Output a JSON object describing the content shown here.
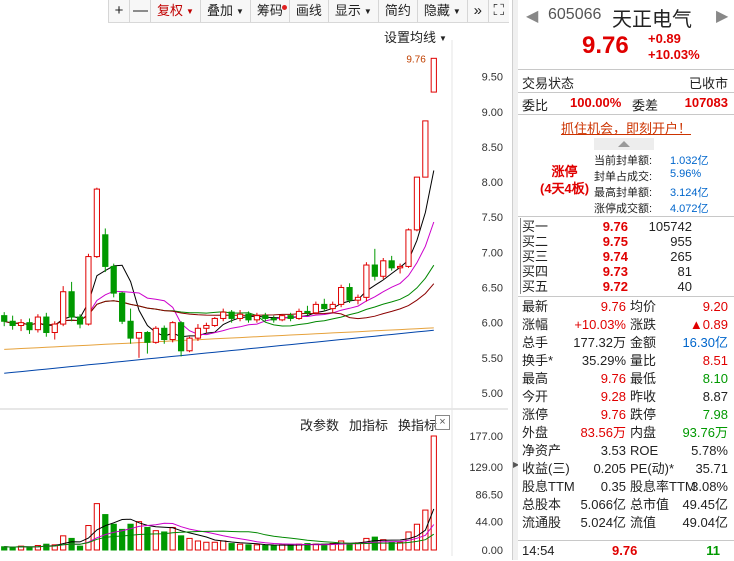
{
  "toolbar": {
    "plus": "+",
    "minus": "—",
    "items": [
      "复权",
      "叠加",
      "筹码",
      "画线",
      "显示",
      "简约",
      "隐藏",
      "»",
      "⛶"
    ]
  },
  "chart": {
    "ma_settings": "设置均线",
    "price_marker": "9.76",
    "y_labels": [
      "9.50",
      "9.00",
      "8.50",
      "8.00",
      "7.50",
      "7.00",
      "6.50",
      "6.00",
      "5.50",
      "5.00"
    ],
    "vol_labels": [
      "177.00",
      "129.00",
      "86.50",
      "44.00",
      "0.00"
    ],
    "indicator_links": [
      "改参数",
      "加指标",
      "换指标"
    ],
    "close": "×"
  },
  "chart_data": {
    "type": "candlestick",
    "ylim": [
      4.9,
      9.85
    ],
    "candles": [
      {
        "o": 6.1,
        "h": 6.15,
        "l": 5.95,
        "c": 6.02
      },
      {
        "o": 6.02,
        "h": 6.1,
        "l": 5.9,
        "c": 5.96
      },
      {
        "o": 5.96,
        "h": 6.05,
        "l": 5.88,
        "c": 6.0
      },
      {
        "o": 6.0,
        "h": 6.06,
        "l": 5.84,
        "c": 5.9
      },
      {
        "o": 5.9,
        "h": 6.12,
        "l": 5.86,
        "c": 6.08
      },
      {
        "o": 6.08,
        "h": 6.14,
        "l": 5.8,
        "c": 5.86
      },
      {
        "o": 5.86,
        "h": 6.02,
        "l": 5.76,
        "c": 5.98
      },
      {
        "o": 5.98,
        "h": 6.52,
        "l": 5.95,
        "c": 6.44
      },
      {
        "o": 6.44,
        "h": 6.58,
        "l": 6.02,
        "c": 6.08
      },
      {
        "o": 6.08,
        "h": 6.12,
        "l": 5.92,
        "c": 5.98
      },
      {
        "o": 5.98,
        "h": 6.98,
        "l": 5.96,
        "c": 6.94
      },
      {
        "o": 6.94,
        "h": 7.92,
        "l": 6.92,
        "c": 7.9
      },
      {
        "o": 7.25,
        "h": 7.34,
        "l": 6.72,
        "c": 6.8
      },
      {
        "o": 6.8,
        "h": 6.84,
        "l": 6.36,
        "c": 6.42
      },
      {
        "o": 6.42,
        "h": 6.44,
        "l": 5.98,
        "c": 6.02
      },
      {
        "o": 6.02,
        "h": 6.2,
        "l": 5.7,
        "c": 5.78
      },
      {
        "o": 5.78,
        "h": 5.82,
        "l": 5.5,
        "c": 5.86
      },
      {
        "o": 5.86,
        "h": 5.88,
        "l": 5.56,
        "c": 5.72
      },
      {
        "o": 5.72,
        "h": 5.95,
        "l": 5.7,
        "c": 5.92
      },
      {
        "o": 5.92,
        "h": 5.96,
        "l": 5.7,
        "c": 5.76
      },
      {
        "o": 5.76,
        "h": 6.02,
        "l": 5.72,
        "c": 6.0
      },
      {
        "o": 6.0,
        "h": 6.02,
        "l": 5.52,
        "c": 5.6
      },
      {
        "o": 5.6,
        "h": 5.8,
        "l": 5.58,
        "c": 5.78
      },
      {
        "o": 5.78,
        "h": 5.98,
        "l": 5.74,
        "c": 5.92
      },
      {
        "o": 5.92,
        "h": 6.0,
        "l": 5.86,
        "c": 5.96
      },
      {
        "o": 5.96,
        "h": 6.08,
        "l": 5.94,
        "c": 6.06
      },
      {
        "o": 6.06,
        "h": 6.2,
        "l": 6.02,
        "c": 6.15
      },
      {
        "o": 6.15,
        "h": 6.18,
        "l": 6.0,
        "c": 6.06
      },
      {
        "o": 6.06,
        "h": 6.18,
        "l": 6.02,
        "c": 6.12
      },
      {
        "o": 6.12,
        "h": 6.16,
        "l": 6.0,
        "c": 6.04
      },
      {
        "o": 6.04,
        "h": 6.14,
        "l": 6.0,
        "c": 6.1
      },
      {
        "o": 6.1,
        "h": 6.14,
        "l": 6.02,
        "c": 6.06
      },
      {
        "o": 6.06,
        "h": 6.1,
        "l": 6.0,
        "c": 6.04
      },
      {
        "o": 6.04,
        "h": 6.12,
        "l": 6.02,
        "c": 6.1
      },
      {
        "o": 6.1,
        "h": 6.14,
        "l": 6.02,
        "c": 6.06
      },
      {
        "o": 6.06,
        "h": 6.2,
        "l": 6.04,
        "c": 6.16
      },
      {
        "o": 6.16,
        "h": 6.24,
        "l": 6.1,
        "c": 6.14
      },
      {
        "o": 6.14,
        "h": 6.3,
        "l": 6.12,
        "c": 6.26
      },
      {
        "o": 6.26,
        "h": 6.34,
        "l": 6.16,
        "c": 6.2
      },
      {
        "o": 6.2,
        "h": 6.3,
        "l": 6.14,
        "c": 6.26
      },
      {
        "o": 6.26,
        "h": 6.54,
        "l": 6.22,
        "c": 6.5
      },
      {
        "o": 6.5,
        "h": 6.56,
        "l": 6.28,
        "c": 6.32
      },
      {
        "o": 6.32,
        "h": 6.4,
        "l": 6.26,
        "c": 6.36
      },
      {
        "o": 6.36,
        "h": 6.86,
        "l": 6.3,
        "c": 6.82
      },
      {
        "o": 6.82,
        "h": 7.05,
        "l": 6.6,
        "c": 6.66
      },
      {
        "o": 6.66,
        "h": 6.92,
        "l": 6.62,
        "c": 6.88
      },
      {
        "o": 6.88,
        "h": 6.95,
        "l": 6.74,
        "c": 6.78
      },
      {
        "o": 6.78,
        "h": 6.84,
        "l": 6.7,
        "c": 6.8
      },
      {
        "o": 6.8,
        "h": 7.34,
        "l": 6.78,
        "c": 7.32
      },
      {
        "o": 7.32,
        "h": 8.07,
        "l": 7.3,
        "c": 8.07
      },
      {
        "o": 8.07,
        "h": 8.87,
        "l": 8.07,
        "c": 8.87
      },
      {
        "o": 9.28,
        "h": 9.76,
        "l": 9.28,
        "c": 9.76
      }
    ],
    "volume_ylim": [
      0,
      177
    ],
    "volumes": [
      5,
      4,
      6,
      4,
      7,
      9,
      8,
      22,
      18,
      6,
      38,
      72,
      55,
      40,
      32,
      40,
      44,
      35,
      30,
      28,
      35,
      22,
      18,
      14,
      12,
      12,
      14,
      10,
      9,
      8,
      8,
      7,
      7,
      8,
      8,
      9,
      10,
      9,
      9,
      10,
      14,
      10,
      11,
      18,
      20,
      16,
      12,
      12,
      28,
      40,
      62,
      177
    ]
  },
  "panel": {
    "code": "605066",
    "name": "天正电气",
    "price": "9.76",
    "change": "+0.89",
    "change_pct": "+10.03%",
    "status_label": "交易状态",
    "status_value": "已收市",
    "wb_label": "委比",
    "wb_value": "100.00%",
    "wc_label": "委差",
    "wc_value": "107083",
    "promo": "抓住机会，即刻开户！",
    "zt_title": "涨停",
    "zt_sub": "(4天4板)",
    "zt_rows": [
      {
        "k": "当前封单额:",
        "v": "1.032亿"
      },
      {
        "k": "封单占成交:",
        "v": "5.96%"
      },
      {
        "k": "最高封单额:",
        "v": "3.124亿"
      },
      {
        "k": "涨停成交额:",
        "v": "4.072亿"
      }
    ],
    "orderbook": [
      {
        "label": "买一",
        "price": "9.76",
        "vol": "105742"
      },
      {
        "label": "买二",
        "price": "9.75",
        "vol": "955"
      },
      {
        "label": "买三",
        "price": "9.74",
        "vol": "265"
      },
      {
        "label": "买四",
        "price": "9.73",
        "vol": "81"
      },
      {
        "label": "买五",
        "price": "9.72",
        "vol": "40"
      }
    ],
    "quotes": [
      {
        "l1": "最新",
        "v1": "9.76",
        "c1": "red",
        "l2": "均价",
        "v2": "9.20",
        "c2": "red"
      },
      {
        "l1": "涨幅",
        "v1": "+10.03%",
        "c1": "red",
        "l2": "涨跌",
        "v2": "▲0.89",
        "c2": "red"
      },
      {
        "l1": "总手",
        "v1": "177.32万",
        "c1": "",
        "l2": "金额",
        "v2": "16.30亿",
        "c2": "blue"
      },
      {
        "l1": "换手*",
        "v1": "35.29%",
        "c1": "",
        "l2": "量比",
        "v2": "8.51",
        "c2": "red"
      },
      {
        "l1": "最高",
        "v1": "9.76",
        "c1": "red",
        "l2": "最低",
        "v2": "8.10",
        "c2": "green"
      },
      {
        "l1": "今开",
        "v1": "9.28",
        "c1": "red",
        "l2": "昨收",
        "v2": "8.87",
        "c2": ""
      },
      {
        "l1": "涨停",
        "v1": "9.76",
        "c1": "red",
        "l2": "跌停",
        "v2": "7.98",
        "c2": "green"
      },
      {
        "l1": "外盘",
        "v1": "83.56万",
        "c1": "red",
        "l2": "内盘",
        "v2": "93.76万",
        "c2": "green"
      },
      {
        "l1": "净资产",
        "v1": "3.53",
        "c1": "",
        "l2": "ROE",
        "v2": "5.78%",
        "c2": ""
      },
      {
        "l1": "收益(三)",
        "v1": "0.205",
        "c1": "",
        "l2": "PE(动)*",
        "v2": "35.71",
        "c2": ""
      },
      {
        "l1": "股息TTM",
        "v1": "0.35",
        "c1": "",
        "l2": "股息率TTM",
        "v2": "3.08%",
        "c2": ""
      },
      {
        "l1": "总股本",
        "v1": "5.066亿",
        "c1": "",
        "l2": "总市值",
        "v2": "49.45亿",
        "c2": ""
      },
      {
        "l1": "流通股",
        "v1": "5.024亿",
        "c1": "",
        "l2": "流值",
        "v2": "49.04亿",
        "c2": ""
      }
    ],
    "foot_time": "14:54",
    "foot_price": "9.76",
    "foot_vol": "11"
  },
  "colors": {
    "up": "#e00000",
    "down": "#009900",
    "ma5": "#000000",
    "ma10": "#cc00cc",
    "ma20": "#008800",
    "ma30": "#8b0000",
    "ma60": "#0044aa",
    "ma120": "#e6a23c"
  }
}
